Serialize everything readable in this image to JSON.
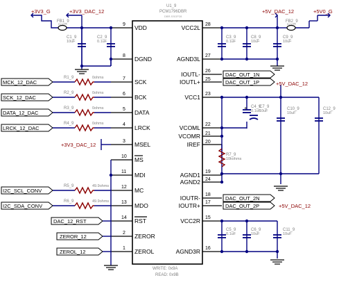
{
  "ic": {
    "ref": "U1_9",
    "part": "PCM1796DBR",
    "footprint": "DBR-SSOP28",
    "left_pins": [
      {
        "num": "9",
        "name": "VDD"
      },
      {
        "num": "8",
        "name": "DGND"
      },
      {
        "num": "7",
        "name": "SCK"
      },
      {
        "num": "6",
        "name": "BCK"
      },
      {
        "num": "5",
        "name": "DATA"
      },
      {
        "num": "4",
        "name": "LRCK"
      },
      {
        "num": "3",
        "name": "MSEL"
      },
      {
        "num": "10",
        "name": "MS"
      },
      {
        "num": "11",
        "name": "MDI"
      },
      {
        "num": "12",
        "name": "MC"
      },
      {
        "num": "13",
        "name": "MDO"
      },
      {
        "num": "14",
        "name": "RST"
      },
      {
        "num": "2",
        "name": "ZEROR"
      },
      {
        "num": "1",
        "name": "ZEROL"
      }
    ],
    "right_pins": [
      {
        "num": "28",
        "name": "VCC2L"
      },
      {
        "num": "27",
        "name": "AGND3L"
      },
      {
        "num": "26",
        "name": "IOUTL-"
      },
      {
        "num": "25",
        "name": "IOUTL+"
      },
      {
        "num": "23",
        "name": "VCC1"
      },
      {
        "num": "22",
        "name": "VCOML"
      },
      {
        "num": "21",
        "name": "VCOMR"
      },
      {
        "num": "20",
        "name": "IREF"
      },
      {
        "num": "19",
        "name": "AGND1"
      },
      {
        "num": "24",
        "name": "AGND2"
      },
      {
        "num": "18",
        "name": "IOUTR-"
      },
      {
        "num": "17",
        "name": "IOUTR+"
      },
      {
        "num": "15",
        "name": "VCC2R"
      },
      {
        "num": "16",
        "name": "AGND3R"
      }
    ],
    "footer": [
      "WRITE: 0x9A",
      "READ: 0x9B"
    ]
  },
  "power": {
    "v3v3_g": "+3V3_G",
    "v3v3_dac": "+3V3_DAC_12",
    "v5_dac_top": "+5V_DAC_12",
    "v5_g": "+5V0_G",
    "v5_dac_mid": "+5V_DAC_12",
    "v5_dac_iout": "+5V_DAC_12",
    "v3v3_dac_msel": "+3V3_DAC_12"
  },
  "nets_in": {
    "mck": "MCK_12_DAC",
    "sck": "SCK_12_DAC",
    "data": "DATA_12_DAC",
    "lrck": "LRCK_12_DAC",
    "i2c_scl": "I2C_SCL_CONV",
    "i2c_sda": "I2C_SDA_CONV",
    "rst": "DAC_12_RST",
    "zeror": "ZEROR_12",
    "zerol": "ZEROL_12"
  },
  "nets_out": {
    "out_1n": "DAC_OUT_1N",
    "out_1p": "DAC_OUT_1P",
    "out_2n": "DAC_OUT_2N",
    "out_2p": "DAC_OUT_2P"
  },
  "resistors": [
    {
      "ref": "R1_9",
      "value": "0ohms"
    },
    {
      "ref": "R2_9",
      "value": "0ohms"
    },
    {
      "ref": "R3_9",
      "value": "0ohms"
    },
    {
      "ref": "R4_9",
      "value": "0ohms"
    },
    {
      "ref": "R5_9",
      "value": "49.9ohms"
    },
    {
      "ref": "R6_9",
      "value": "49.9ohms"
    },
    {
      "ref": "R7_9",
      "value": "10kohms"
    }
  ],
  "ferrites": [
    {
      "ref": "FB1_9",
      "part": "BLM18"
    },
    {
      "ref": "FB2_9",
      "part": "BLM18"
    }
  ],
  "capacitors": [
    {
      "ref": "C1_9",
      "value": "10uF"
    },
    {
      "ref": "C2_9",
      "value": "0.1uF"
    },
    {
      "ref": "C3_9",
      "value": "0.1uF"
    },
    {
      "ref": "C8_9",
      "value": "10uF"
    },
    {
      "ref": "C9_9",
      "value": "10uF"
    },
    {
      "ref": "C4_9",
      "value": "0.1uF"
    },
    {
      "ref": "C7_9",
      "value": "10uF"
    },
    {
      "ref": "C10_9",
      "value": "10uF"
    },
    {
      "ref": "C12_9",
      "value": "10uF"
    },
    {
      "ref": "C5_9",
      "value": "0.1uF"
    },
    {
      "ref": "C6_9",
      "value": "10uF"
    },
    {
      "ref": "C11_9",
      "value": "10uF"
    }
  ]
}
